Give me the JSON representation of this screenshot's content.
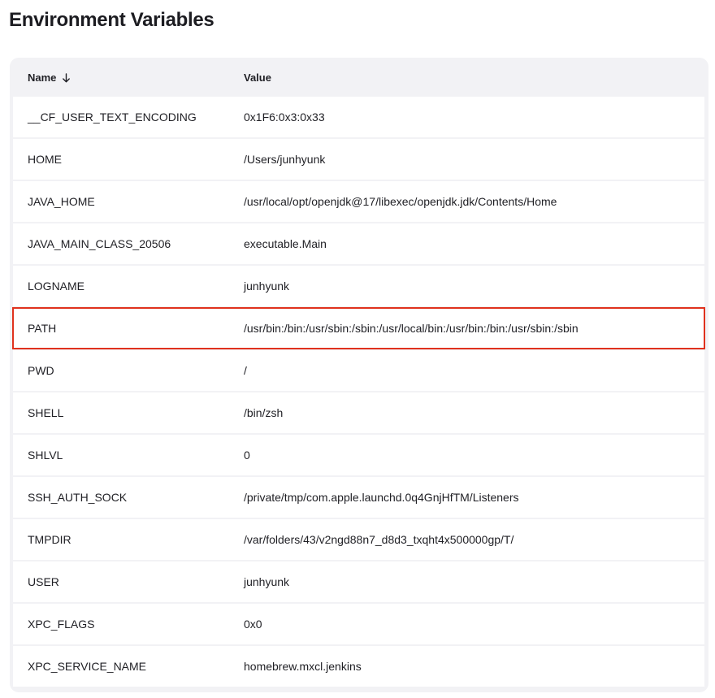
{
  "page": {
    "title": "Environment Variables"
  },
  "table": {
    "columns": {
      "name": "Name",
      "value": "Value"
    },
    "sort_icon": "arrow-down-icon",
    "highlight_color": "#e0321e",
    "rows": [
      {
        "name": "__CF_USER_TEXT_ENCODING",
        "value": "0x1F6:0x3:0x33"
      },
      {
        "name": "HOME",
        "value": "/Users/junhyunk"
      },
      {
        "name": "JAVA_HOME",
        "value": "/usr/local/opt/openjdk@17/libexec/openjdk.jdk/Contents/Home"
      },
      {
        "name": "JAVA_MAIN_CLASS_20506",
        "value": "executable.Main"
      },
      {
        "name": "LOGNAME",
        "value": "junhyunk"
      },
      {
        "name": "PATH",
        "value": "/usr/bin:/bin:/usr/sbin:/sbin:/usr/local/bin:/usr/bin:/bin:/usr/sbin:/sbin",
        "highlighted": true
      },
      {
        "name": "PWD",
        "value": "/"
      },
      {
        "name": "SHELL",
        "value": "/bin/zsh"
      },
      {
        "name": "SHLVL",
        "value": "0"
      },
      {
        "name": "SSH_AUTH_SOCK",
        "value": "/private/tmp/com.apple.launchd.0q4GnjHfTM/Listeners"
      },
      {
        "name": "TMPDIR",
        "value": "/var/folders/43/v2ngd88n7_d8d3_txqht4x500000gp/T/"
      },
      {
        "name": "USER",
        "value": "junhyunk"
      },
      {
        "name": "XPC_FLAGS",
        "value": "0x0"
      },
      {
        "name": "XPC_SERVICE_NAME",
        "value": "homebrew.mxcl.jenkins"
      }
    ]
  }
}
